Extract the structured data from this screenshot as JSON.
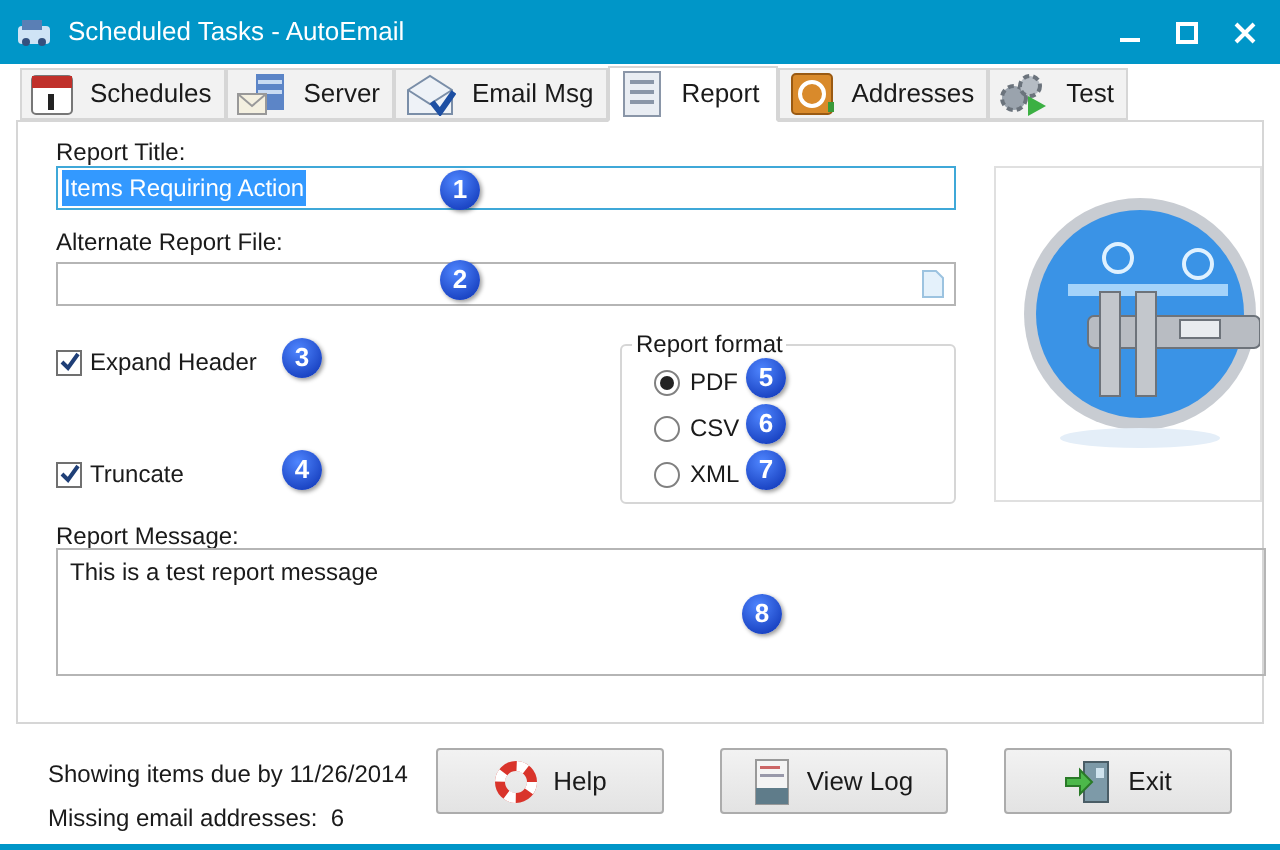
{
  "window": {
    "title": "Scheduled Tasks - AutoEmail"
  },
  "tabs": [
    {
      "label": "Schedules",
      "selected": false
    },
    {
      "label": "Server",
      "selected": false
    },
    {
      "label": "Email Msg",
      "selected": false
    },
    {
      "label": "Report",
      "selected": true
    },
    {
      "label": "Addresses",
      "selected": false
    },
    {
      "label": "Test",
      "selected": false
    }
  ],
  "report_title": {
    "label": "Report Title:",
    "value": "Items Requiring Action",
    "highlighted": true,
    "badge": "1"
  },
  "alternate_file": {
    "label": "Alternate Report File:",
    "badge": "2"
  },
  "options": [
    {
      "label": "Expand Header",
      "checked": true,
      "badge": "3"
    },
    {
      "label": "Truncate",
      "checked": true,
      "badge": "4"
    }
  ],
  "report_format": {
    "title": "Report format",
    "options": [
      {
        "label": "PDF",
        "selected": true,
        "badge": "5"
      },
      {
        "label": "CSV",
        "selected": false,
        "badge": "6"
      },
      {
        "label": "XML",
        "selected": false,
        "badge": "7"
      }
    ]
  },
  "report_message": {
    "label": "Report Message:",
    "value": "This is a test report message",
    "badge": "8"
  },
  "status": [
    "Showing items due by 11/26/2014",
    "Missing email addresses:  6"
  ],
  "buttons": [
    {
      "kind": "help",
      "label": "Help"
    },
    {
      "kind": "log",
      "label": "View Log"
    },
    {
      "kind": "exit",
      "label": "Exit"
    }
  ]
}
